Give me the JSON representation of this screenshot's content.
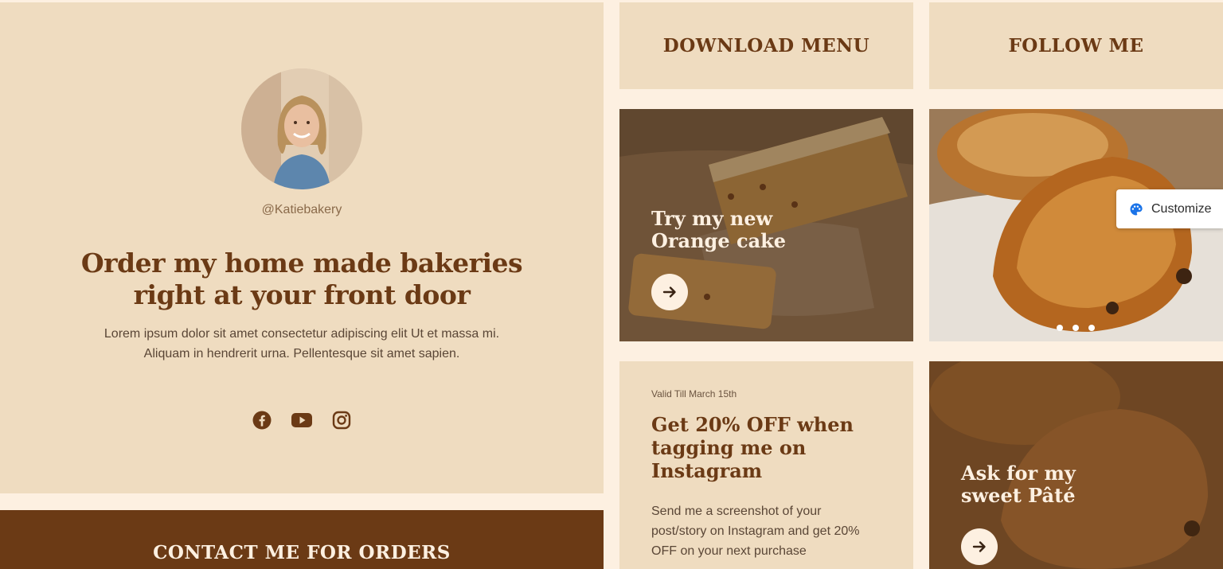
{
  "hero": {
    "handle": "@Katiebakery",
    "headline": [
      "Order my home made bakeries",
      "right at your front door"
    ],
    "description": [
      "Lorem ipsum dolor sit amet consectetur adipiscing elit Ut et massa mi.",
      "Aliquam in hendrerit urna. Pellentesque sit amet sapien."
    ],
    "socials": [
      "facebook-icon",
      "youtube-icon",
      "instagram-icon"
    ]
  },
  "contact": {
    "title": "CONTACT ME FOR ORDERS"
  },
  "menu": {
    "download_label": "DOWNLOAD MENU",
    "follow_label": "FOLLOW ME"
  },
  "cake_card": {
    "title": [
      "Try my new",
      "Orange cake"
    ],
    "icon": "arrow-right-icon"
  },
  "promo": {
    "valid": "Valid Till March 15th",
    "title": [
      "Get 20% OFF when",
      "tagging me on",
      "Instagram"
    ],
    "text": [
      "Send me a screenshot of your",
      "post/story on Instagram and get 20%",
      "OFF on your next purchase"
    ]
  },
  "pate_card": {
    "title": [
      "Ask for my",
      "sweet Pâté"
    ],
    "icon": "arrow-right-icon"
  },
  "carousel": {
    "dot_count": 3
  },
  "customize": {
    "label": "Customize",
    "icon": "palette-icon"
  },
  "colors": {
    "background": "#fdf0e1",
    "panel": "#efdcc0",
    "brand_brown": "#6b3a15",
    "cream": "#fdf0e1",
    "customize_icon": "#1a73e8"
  }
}
